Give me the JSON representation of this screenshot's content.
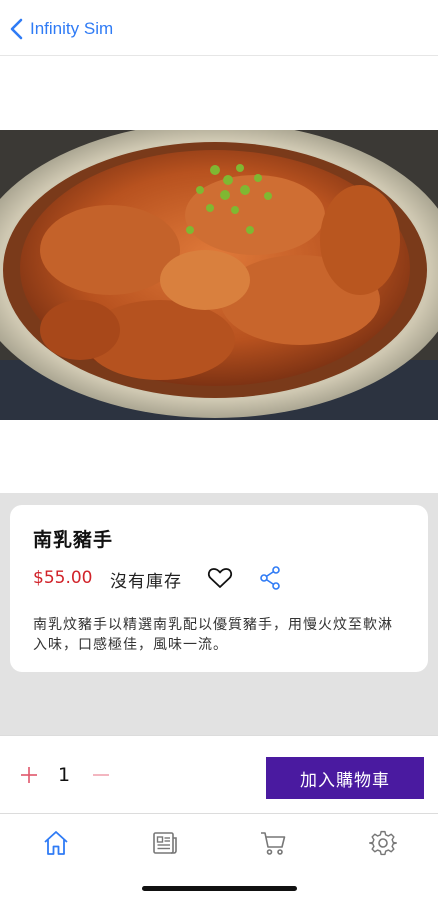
{
  "nav": {
    "back_label": "Infinity Sim"
  },
  "product": {
    "title": "南乳豬手",
    "price": "$55.00",
    "stock_status": "沒有庫存",
    "description": "南乳炆豬手以精選南乳配以優質豬手，用慢火炆至軟淋入味，口感極佳，風味一流。",
    "image_icon": "braised-pork-knuckle-photo"
  },
  "cart": {
    "quantity": "1",
    "add_label": "加入購物車"
  },
  "tabs": [
    {
      "icon": "home-icon",
      "active": true
    },
    {
      "icon": "news-icon",
      "active": false
    },
    {
      "icon": "cart-icon",
      "active": false
    },
    {
      "icon": "settings-icon",
      "active": false
    }
  ],
  "colors": {
    "accent_blue": "#2f7bf5",
    "price_red": "#d1232a",
    "button_purple": "#4a1aa0"
  }
}
